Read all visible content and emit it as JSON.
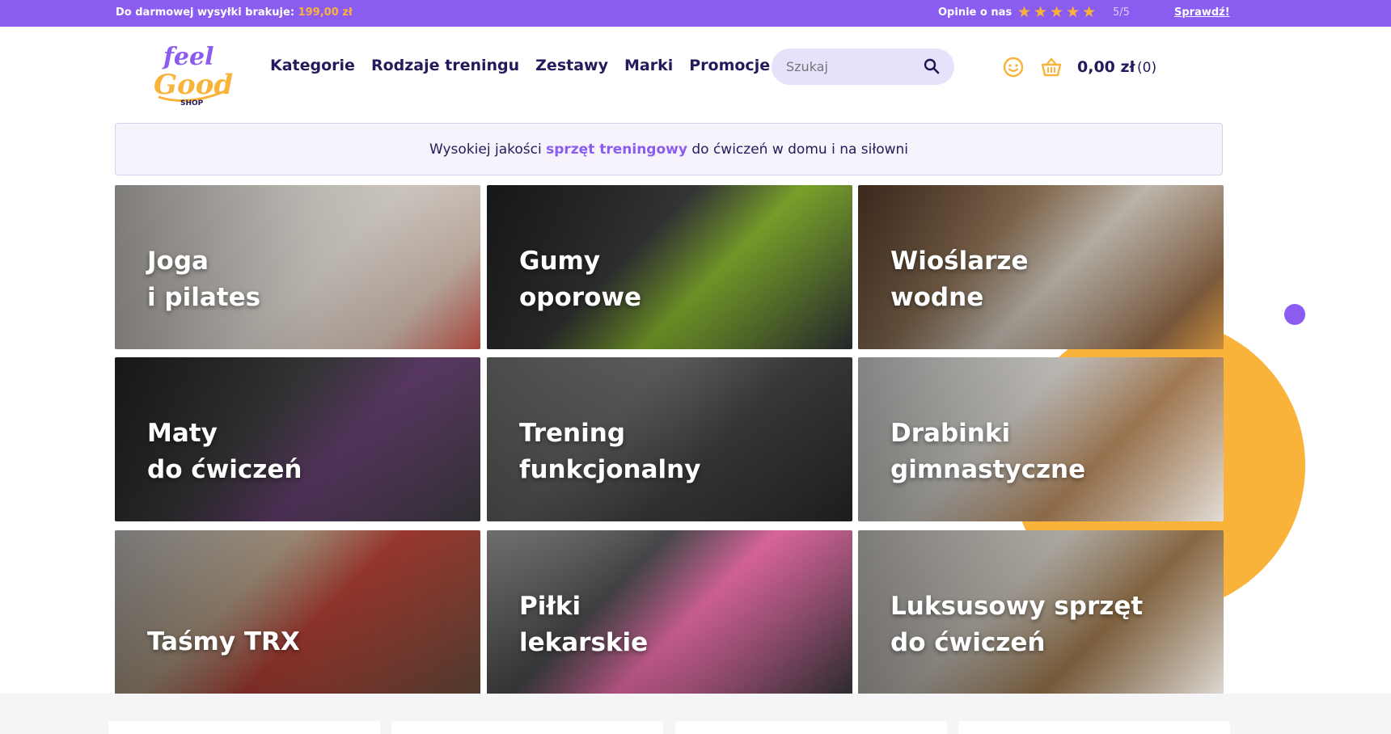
{
  "topbar": {
    "shipping_prefix": "Do darmowej wysyłki brakuje:",
    "shipping_amount": "199,00 zł",
    "reviews_label": "Opinie o nas",
    "stars": "★★★★★",
    "score": "5/5",
    "check_link": "Sprawdź!"
  },
  "logo": {
    "line1": "feel",
    "line2": "Good",
    "line3": "SHOP"
  },
  "nav": {
    "items": [
      "Kategorie",
      "Rodzaje treningu",
      "Zestawy",
      "Marki",
      "Promocje"
    ]
  },
  "search": {
    "placeholder": "Szukaj"
  },
  "cart": {
    "total": "0,00 zł",
    "count": "(0)"
  },
  "banner": {
    "before": "Wysokiej jakości",
    "highlight": "sprzęt treningowy",
    "after": "do ćwiczeń w domu i na siłowni"
  },
  "tiles": [
    {
      "line1": "Joga",
      "line2": "i pilates"
    },
    {
      "line1": "Gumy",
      "line2": "oporowe"
    },
    {
      "line1": "Wioślarze",
      "line2": "wodne"
    },
    {
      "line1": "Maty",
      "line2": "do ćwiczeń"
    },
    {
      "line1": "Trening",
      "line2": "funkcjonalny"
    },
    {
      "line1": "Drabinki",
      "line2": "gimnastyczne"
    },
    {
      "line1": "Taśmy TRX",
      "line2": ""
    },
    {
      "line1": "Piłki",
      "line2": "lekarskie"
    },
    {
      "line1": "Luksusowy sprzęt",
      "line2": "do ćwiczeń"
    }
  ],
  "colors": {
    "brand_purple": "#8b5cf0",
    "brand_orange": "#f9b33a",
    "text_navy": "#241a5c"
  }
}
